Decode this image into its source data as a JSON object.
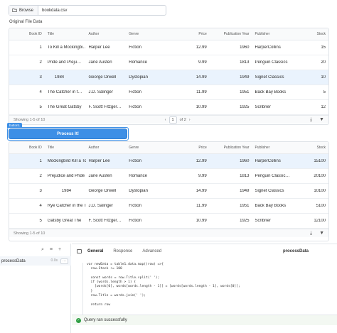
{
  "file_picker": {
    "browse_label": "Browse",
    "file_name": "bookdata.csv"
  },
  "original_table": {
    "label": "Original File Data",
    "columns": [
      "Book ID",
      "Title",
      "Author",
      "Genre",
      "Price",
      "Publication Year",
      "Publisher",
      "Stock"
    ],
    "rows": [
      [
        "1",
        "To Kill a Mockingbi…",
        "Harper Lee",
        "Fiction",
        "12.99",
        "1960",
        "HarperCollins",
        "15"
      ],
      [
        "2",
        "Pride and Preju…",
        "Jane Austen",
        "Romance",
        "9.99",
        "1813",
        "Penguin Classics",
        "20"
      ],
      [
        "3",
        "      1984",
        "George Orwell",
        "Dystopian",
        "14.99",
        "1949",
        "Signet Classics",
        "10"
      ],
      [
        "4",
        "The Catcher in t…",
        "J.D. Salinger",
        "Fiction",
        "11.99",
        "1951",
        "Back Bay Books",
        "5"
      ],
      [
        "5",
        "The Great Gatsby",
        "F. Scott Fitzger…",
        "Fiction",
        "10.99",
        "1925",
        "Scribner",
        "12"
      ]
    ],
    "selected_row": 2,
    "footer": {
      "showing": "Showing 1-5 of 10",
      "page": "1",
      "of_pages": "of 2"
    }
  },
  "process_button": {
    "tag": "button1",
    "label": "Process It!"
  },
  "processed_table": {
    "columns": [
      "Book ID",
      "Title",
      "Author",
      "Genre",
      "Price",
      "Publication Year",
      "Publisher",
      "Stock"
    ],
    "rows": [
      [
        "1",
        "Mockingbird Kill a To",
        "Harper Lee",
        "Fiction",
        "12.99",
        "1960",
        "HarperCollins",
        "15100"
      ],
      [
        "2",
        "Prejudice and Pride",
        "Jane Austen",
        "Romance",
        "9.99",
        "1813",
        "Penguin Classic…",
        "20100"
      ],
      [
        "3",
        "            1984",
        "George Orwell",
        "Dystopian",
        "14.99",
        "1949",
        "Signet Classics",
        "10100"
      ],
      [
        "4",
        "Rye Catcher in the The",
        "J.D. Salinger",
        "Fiction",
        "11.99",
        "1951",
        "Back Bay Books",
        "5100"
      ],
      [
        "5",
        "Gatsby Great The",
        "F. Scott Fitzger…",
        "Fiction",
        "10.99",
        "1925",
        "Scribner",
        "12100"
      ]
    ],
    "selected_row": 0,
    "footer": {
      "showing": "Showing 1-5 of 10"
    }
  },
  "query_panel": {
    "query_name": "processData",
    "query_meta": "0.0s"
  },
  "editor": {
    "tabs": [
      "General",
      "Response",
      "Advanced"
    ],
    "title": "processData",
    "code_lines": [
      "var newData = table1.data.map((row) =>{",
      "  row.Stock += 100",
      "",
      "  const words = row.Title.split(' ');",
      "  if (words.length > 1) {",
      "    [words[0], words[words.length - 1]] = [words[words.length - 1], words[0]];",
      "  }",
      "  row.Title = words.join(' ');",
      "",
      "  return row"
    ],
    "status": "Query ran successfully"
  },
  "colors": {
    "accent": "#3d8fe6",
    "success": "#2f9e44",
    "selected_row": "#eaf3fd"
  }
}
